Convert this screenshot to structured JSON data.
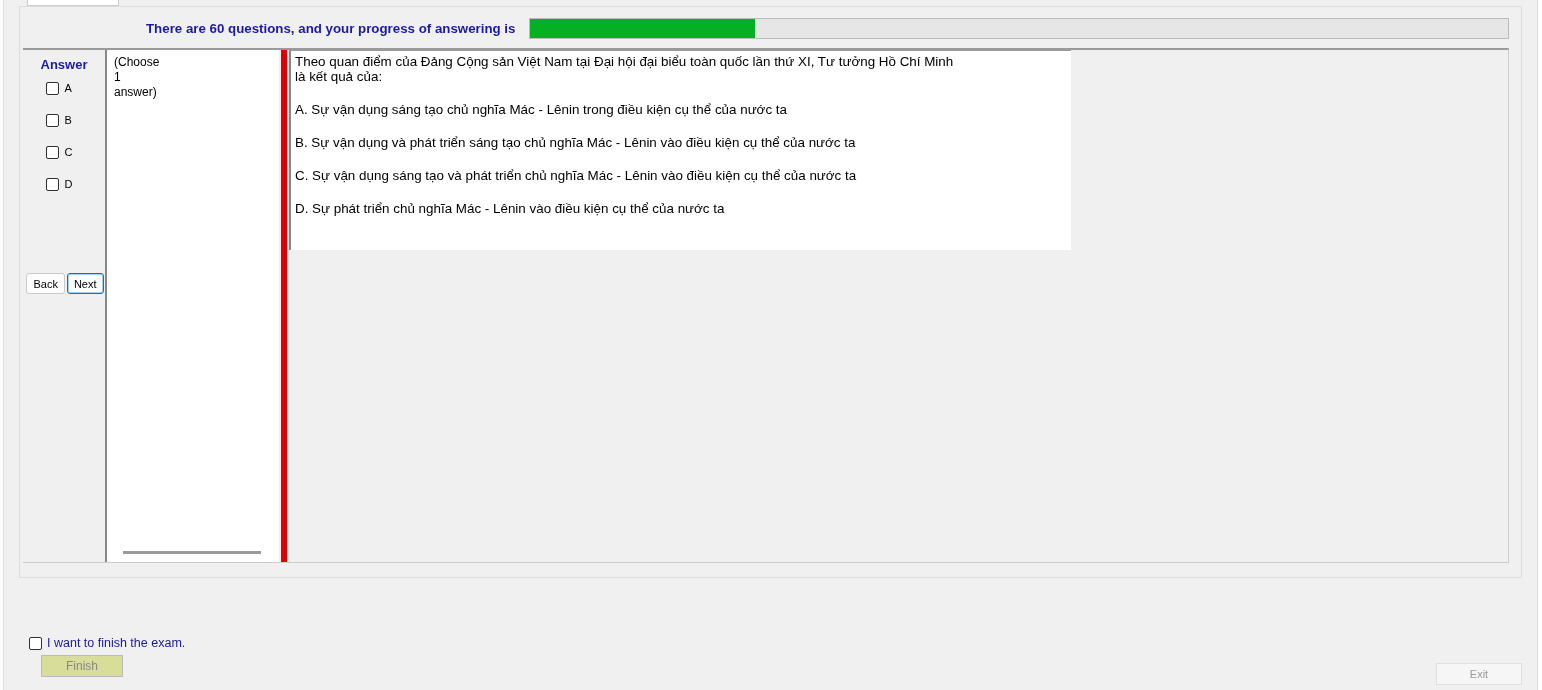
{
  "header": {
    "text": "There are 60 questions, and your progress of answering is",
    "progress": {
      "level": 0.23
    }
  },
  "answer_panel": {
    "title": "Answer",
    "options": [
      {
        "label": "A",
        "checked": false
      },
      {
        "label": "B",
        "checked": false
      },
      {
        "label": "C",
        "checked": false
      },
      {
        "label": "D",
        "checked": false
      }
    ],
    "buttons": [
      {
        "label": "Back",
        "selected": false
      },
      {
        "label": "Next",
        "selected": true
      }
    ]
  },
  "instruction_lines": [
    "(Choose",
    "1",
    "answer)"
  ],
  "question": {
    "stem_lines": [
      "Theo quan điểm của Đảng Cộng sản Việt Nam tại Đại hội đại biểu toàn quốc lần thứ XI, Tư tưởng Hồ Chí Minh",
      "là kết quả của:"
    ],
    "choices": [
      "A.  Sự vận dụng sáng tạo chủ nghĩa Mác - Lênin trong điều kiện cụ thể của nước ta",
      "B.  Sự vận dụng và phát triển sáng tạo chủ nghĩa Mác - Lênin vào điều kiện cụ thể của nước ta",
      "C.  Sự vận dụng sáng tạo và phát triển chủ nghĩa Mác - Lênin vào điều kiện cụ thể của nước ta",
      "D.  Sự phát triển chủ nghĩa Mác - Lênin vào điều kiện cụ thể của nước ta"
    ]
  },
  "finish": {
    "label": "I want to finish the exam.",
    "checked": false,
    "button": {
      "label": "Finish",
      "disabled": true
    }
  },
  "exit_button": {
    "label": "Exit",
    "disabled": true
  }
}
